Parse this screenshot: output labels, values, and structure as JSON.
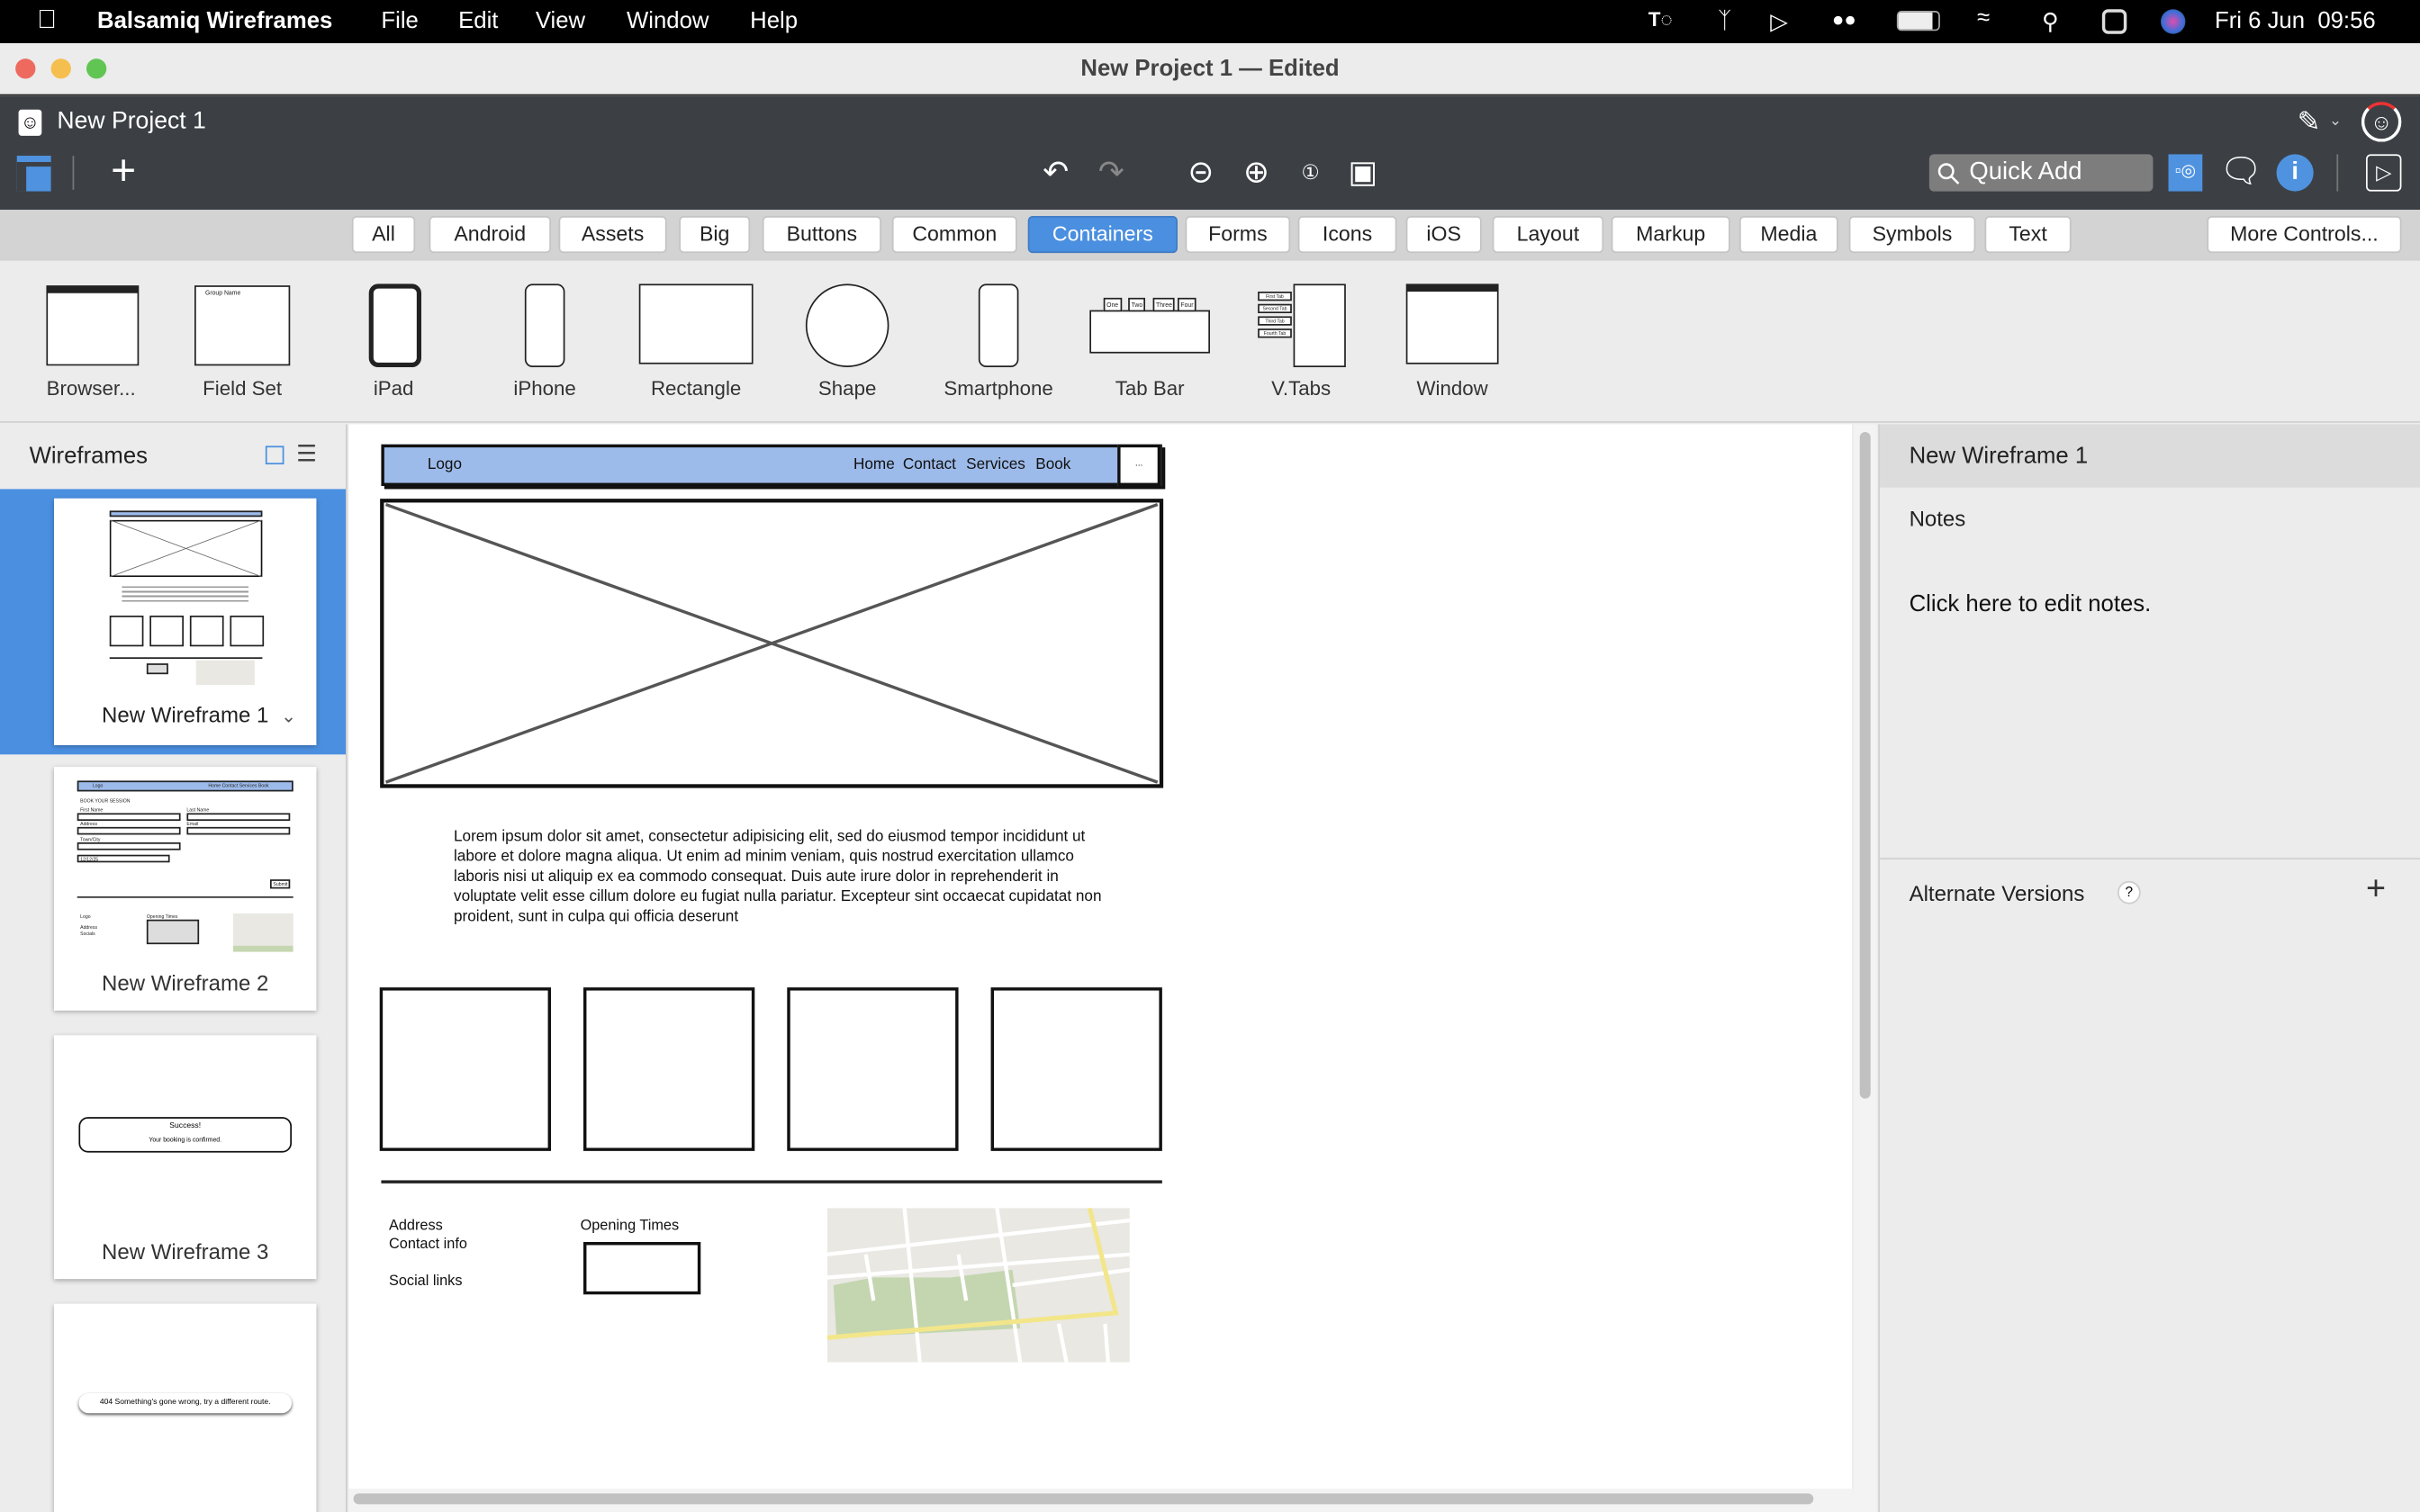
{
  "menubar": {
    "app": "Balsamiq Wireframes",
    "menus": [
      "File",
      "Edit",
      "View",
      "Window",
      "Help"
    ],
    "datetime": "Fri 6 Jun  09:56",
    "icons": [
      "apple-icon",
      "teams-icon",
      "bluetooth-icon",
      "play-icon",
      "airpods-icon",
      "battery-icon",
      "wifi-icon",
      "spotlight-icon",
      "control-center-icon",
      "siri-icon"
    ]
  },
  "window": {
    "title": "New Project 1 — Edited"
  },
  "toolbar": {
    "project": "New Project 1",
    "quick_add": "Quick Add"
  },
  "tabs": {
    "items": [
      "All",
      "Android",
      "Assets",
      "Big",
      "Buttons",
      "Common",
      "Containers",
      "Forms",
      "Icons",
      "iOS",
      "Layout",
      "Markup",
      "Media",
      "Symbols",
      "Text"
    ],
    "selected": "Containers",
    "more": "More Controls..."
  },
  "library": [
    "Browser...",
    "Field Set",
    "iPad",
    "iPhone",
    "Rectangle",
    "Shape",
    "Smartphone",
    "Tab Bar",
    "V.Tabs",
    "Window"
  ],
  "library_tabbar": [
    "One",
    "Two",
    "Three",
    "Four"
  ],
  "library_vtabs": [
    "First Tab",
    "Second Tab",
    "Third Tab",
    "Fourth Tab"
  ],
  "library_fieldset": "Group Name",
  "sidebar": {
    "title": "Wireframes",
    "thumbnails": [
      {
        "name": "New Wireframe 1",
        "selected": true
      },
      {
        "name": "New Wireframe 2",
        "content": {
          "logo": "Logo",
          "nav": "Home Contact Services Book",
          "heading": "BOOK YOUR SESSION",
          "fields": [
            "First Name",
            "Last Name",
            "Address",
            "Email",
            "Town/City"
          ],
          "date": "12/12/25",
          "submit": "Submit",
          "footer_logo": "Logo",
          "opening": "Opening Times",
          "address": "Address",
          "socials": "Socials"
        }
      },
      {
        "name": "New Wireframe 3",
        "content": {
          "title": "Success!",
          "message": "Your booking is confirmed."
        }
      },
      {
        "name": "",
        "content": {
          "message": "404 Something's gone wrong, try a different route."
        }
      }
    ]
  },
  "canvas": {
    "nav": {
      "logo": "Logo",
      "links": [
        "Home",
        "Contact",
        "Services",
        "Book"
      ],
      "more": "..."
    },
    "paragraph": "Lorem ipsum dolor sit amet, consectetur adipisicing elit, sed do eiusmod tempor incididunt ut labore et dolore magna aliqua. Ut enim ad minim veniam, quis nostrud exercitation ullamco laboris nisi ut aliquip ex ea commodo consequat. Duis aute irure dolor in reprehenderit in voluptate velit esse cillum dolore eu fugiat nulla pariatur. Excepteur sint occaecat cupidatat non proident, sunt in culpa qui officia deserunt",
    "footer": {
      "address": "Address",
      "contact": "Contact info",
      "social": "Social links",
      "opening": "Opening Times"
    },
    "nav_color": "#9dbbea"
  },
  "inspector": {
    "title": "New Wireframe 1",
    "notes_label": "Notes",
    "notes_placeholder": "Click here to edit notes.",
    "alt_versions": "Alternate Versions",
    "help": "?",
    "add": "+"
  },
  "colors": {
    "accent": "#4a8fe0",
    "toolbar": "#3c4045"
  }
}
